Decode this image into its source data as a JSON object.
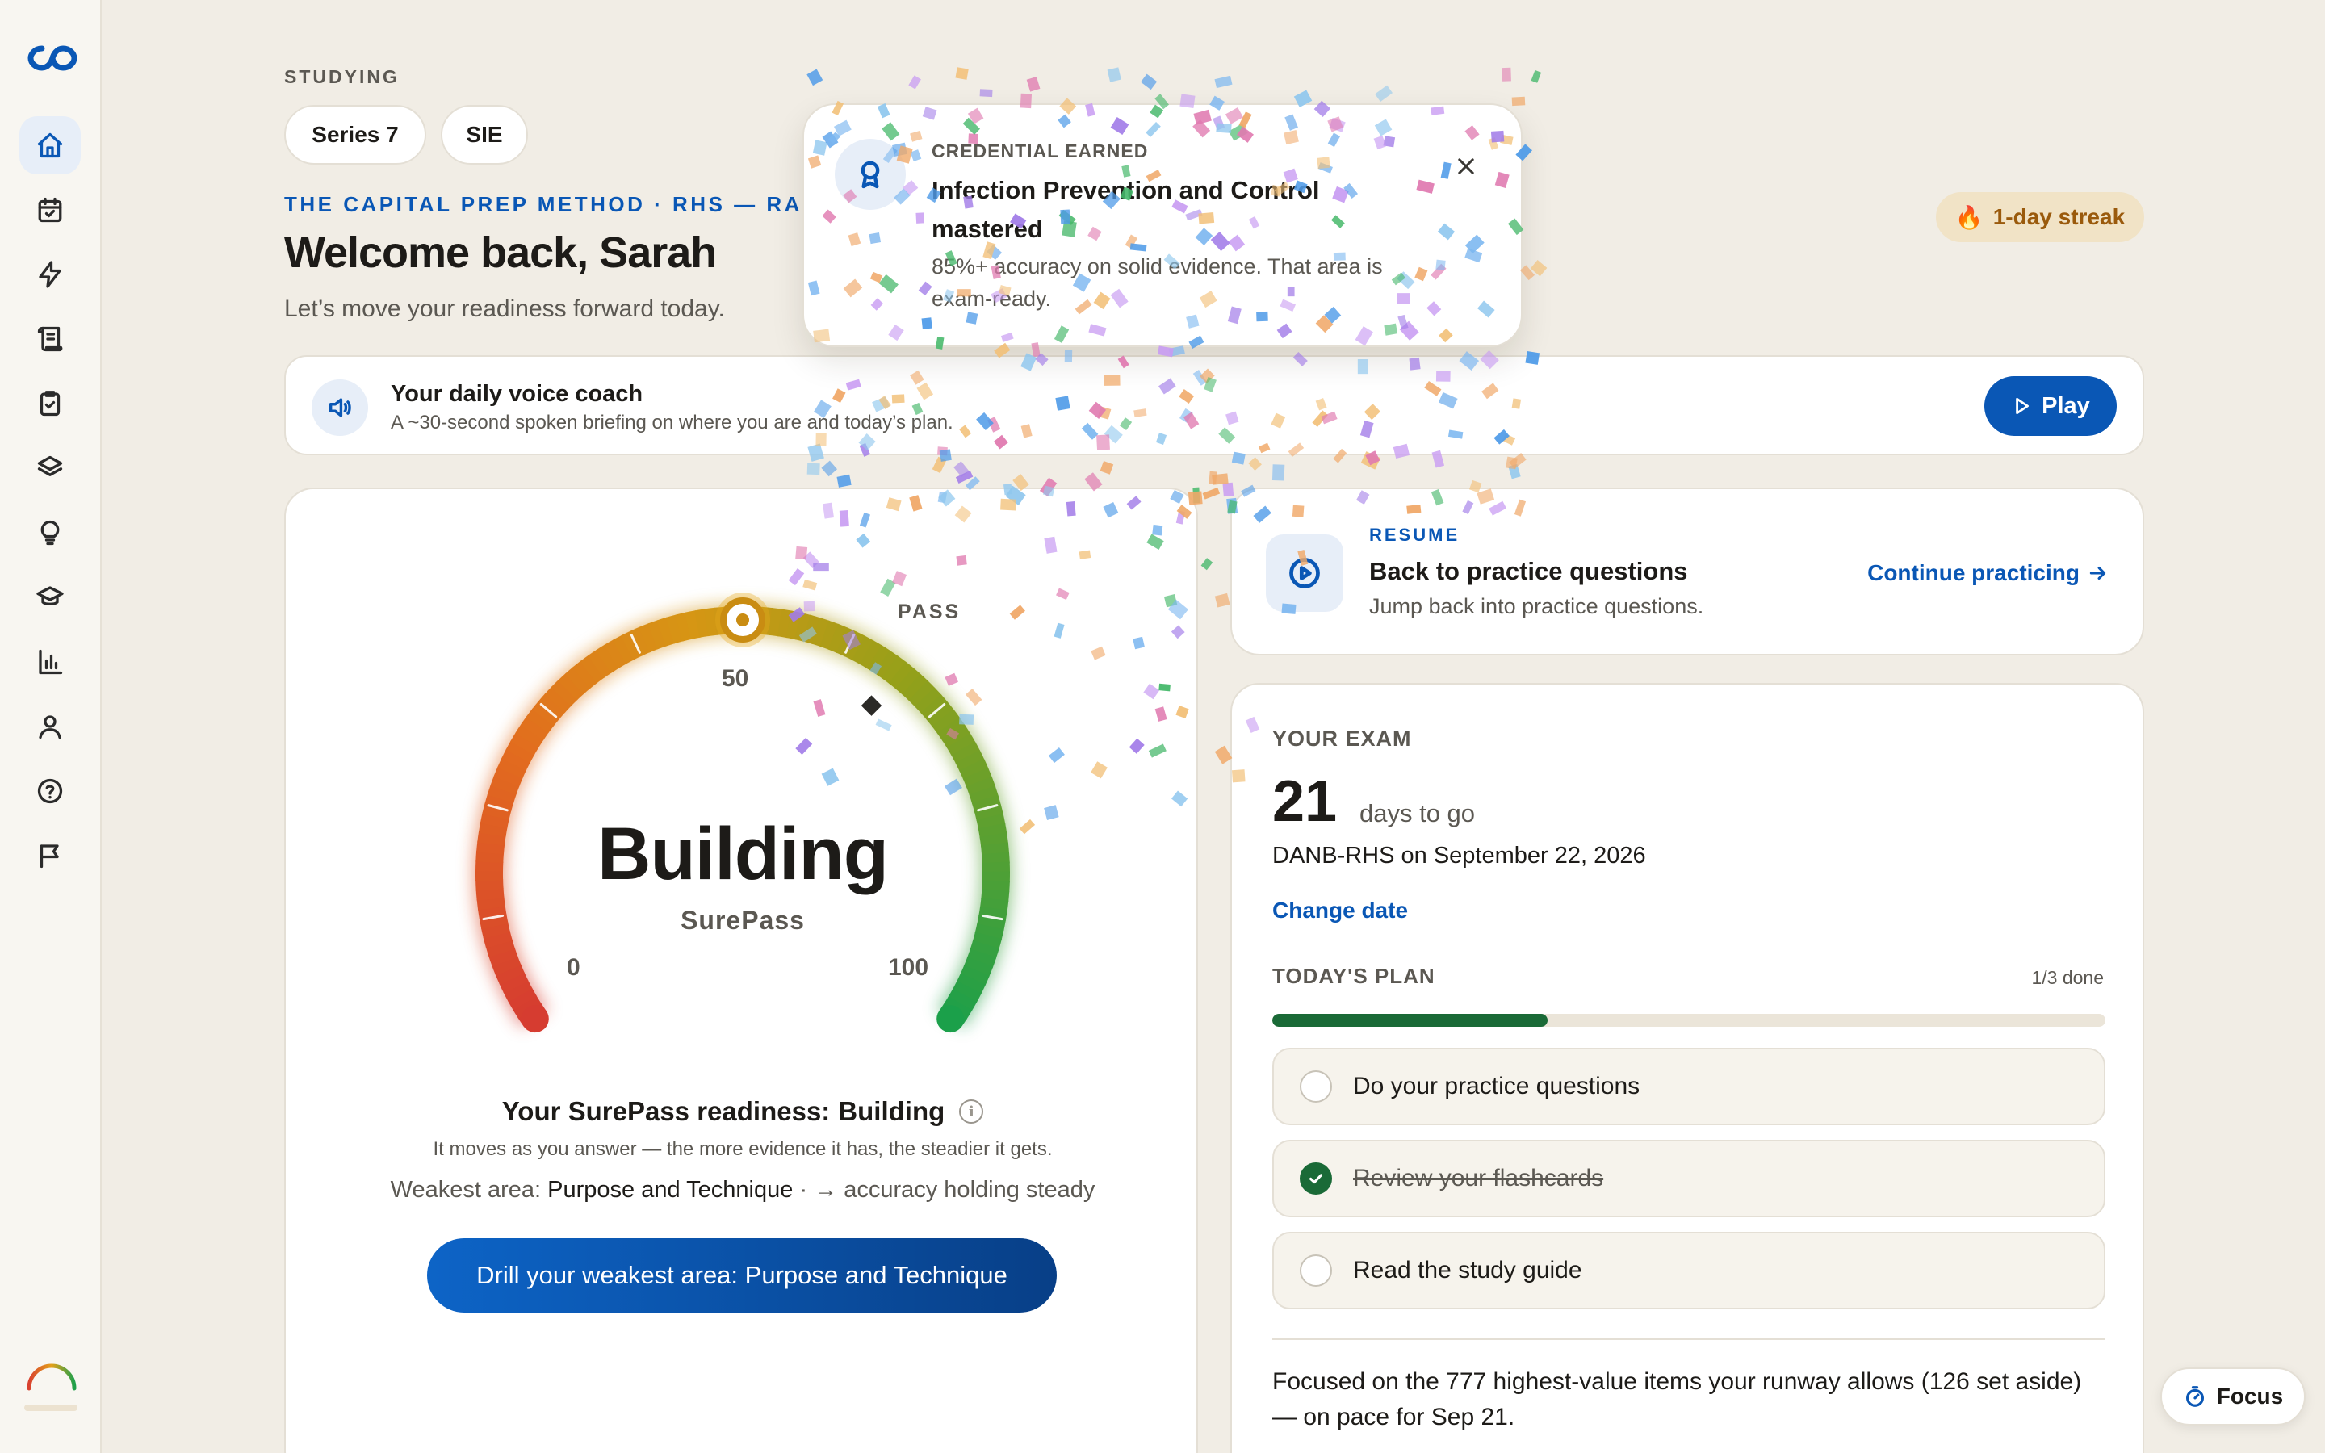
{
  "sidebar": {
    "items": [
      {
        "name": "home",
        "icon": "home-icon",
        "active": true
      },
      {
        "name": "calendar",
        "icon": "calendar-check-icon"
      },
      {
        "name": "quick",
        "icon": "lightning-icon"
      },
      {
        "name": "study-guide",
        "icon": "scroll-icon"
      },
      {
        "name": "practice",
        "icon": "clipboard-check-icon"
      },
      {
        "name": "flashcards",
        "icon": "layers-icon"
      },
      {
        "name": "tips",
        "icon": "lightbulb-icon"
      },
      {
        "name": "courses",
        "icon": "graduation-cap-icon"
      },
      {
        "name": "analytics",
        "icon": "bar-chart-icon"
      },
      {
        "name": "profile",
        "icon": "user-icon"
      },
      {
        "name": "help",
        "icon": "help-circle-icon"
      },
      {
        "name": "report",
        "icon": "flag-icon"
      }
    ]
  },
  "header": {
    "studying_label": "STUDYING",
    "exams": [
      "Series 7",
      "SIE"
    ],
    "method_line": "THE CAPITAL PREP METHOD · RHS — RADIAT",
    "welcome": "Welcome back, Sarah",
    "subtitle": "Let’s move your readiness forward today.",
    "streak": "1-day streak"
  },
  "voice_coach": {
    "title": "Your daily voice coach",
    "description": "A ~30-second spoken briefing on where you are and today’s plan.",
    "play_label": "Play"
  },
  "readiness": {
    "gauge": {
      "status_word": "Building",
      "brand": "SurePass",
      "min_label": "0",
      "mid_label": "50",
      "max_label": "100",
      "pass_label": "PASS",
      "value": 50,
      "pass_value": 65
    },
    "headline_prefix": "Your SurePass readiness:",
    "headline_value": "Building",
    "info_icon": "i",
    "hint": "It moves as you answer — the more evidence it has, the steadier it gets.",
    "weak_prefix": "Weakest area:",
    "weak_area": "Purpose and Technique",
    "weak_suffix": "· → accuracy holding steady",
    "drill_label": "Drill your weakest area: Purpose and Technique"
  },
  "resume": {
    "eyebrow": "RESUME",
    "title": "Back to practice questions",
    "description": "Jump back into practice questions.",
    "continue_label": "Continue practicing"
  },
  "exam": {
    "eyebrow": "YOUR EXAM",
    "days": "21",
    "days_text": "days to go",
    "date_line": "DANB-RHS on September 22, 2026",
    "change_date": "Change date",
    "plan_eyebrow": "TODAY'S PLAN",
    "plan_count": "1/3 done",
    "plan_progress": 0.33,
    "tasks": [
      {
        "label": "Do your practice questions",
        "done": false
      },
      {
        "label": "Review your flashcards",
        "done": true
      },
      {
        "label": "Read the study guide",
        "done": false
      }
    ],
    "focus_note": "Focused on the 777 highest-value items your runway allows (126 set aside) — on pace for Sep 21."
  },
  "toast": {
    "eyebrow": "CREDENTIAL EARNED",
    "title": "Infection Prevention and Control mastered",
    "description": "85%+ accuracy on solid evidence. That area is exam-ready."
  },
  "focus_button": {
    "label": "Focus"
  },
  "colors": {
    "accent": "#0a57b5",
    "success": "#1a6a37",
    "background": "#f1ede5",
    "streak_bg": "#f1e3c6",
    "streak_text": "#9a5a0c"
  }
}
